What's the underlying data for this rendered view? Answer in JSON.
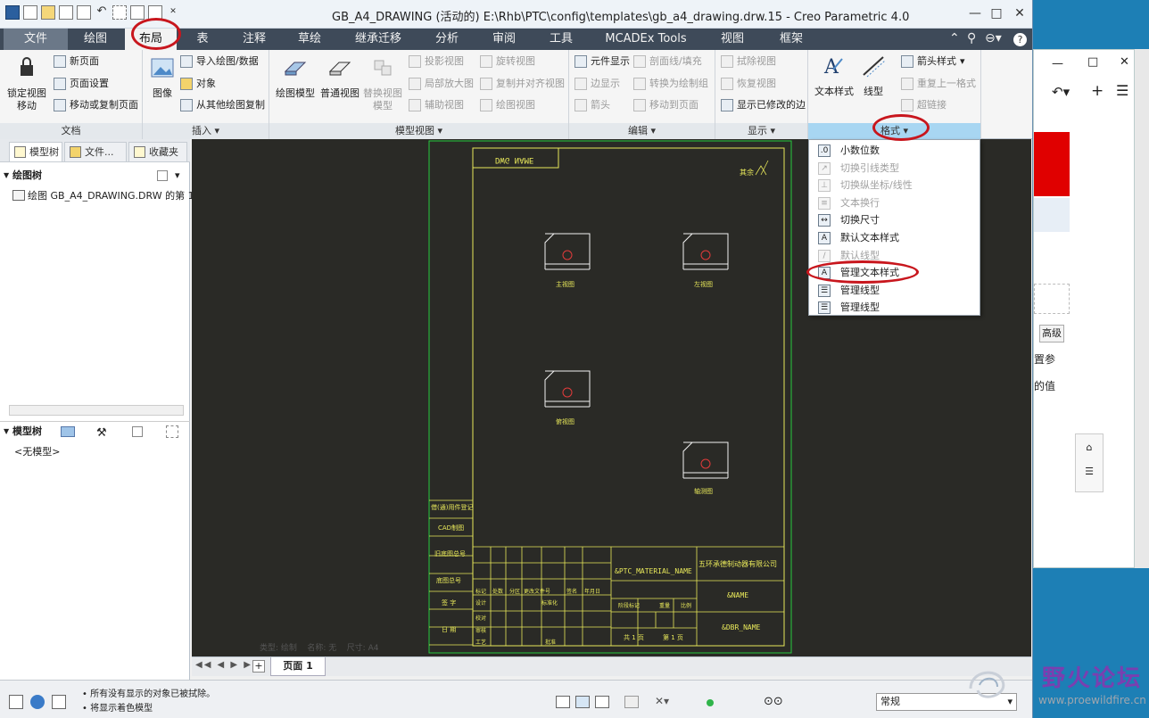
{
  "window": {
    "title": "GB_A4_DRAWING (活动的) E:\\Rhb\\PTC\\config\\templates\\gb_a4_drawing.drw.15 - Creo Parametric 4.0",
    "minimize": "—",
    "maximize": "□",
    "close": "✕"
  },
  "tabs": [
    {
      "label": "文件"
    },
    {
      "label": "绘图"
    },
    {
      "label": "布局"
    },
    {
      "label": "表"
    },
    {
      "label": "注释"
    },
    {
      "label": "草绘"
    },
    {
      "label": "继承迁移"
    },
    {
      "label": "分析"
    },
    {
      "label": "审阅"
    },
    {
      "label": "工具"
    },
    {
      "label": "MCADEx Tools"
    },
    {
      "label": "视图"
    },
    {
      "label": "框架"
    }
  ],
  "ribbon": {
    "doc": {
      "lock_view_move": "锁定视图\n移动",
      "new_page": "新页面",
      "page_setup": "页面设置",
      "move_copy_page": "移动或复制页面",
      "footer": "文档"
    },
    "insert": {
      "image": "图像",
      "import_drawing": "导入绘图/数据",
      "object": "对象",
      "copy_from_drawing": "从其他绘图复制",
      "footer": "插入"
    },
    "model_views": {
      "general_model": "绘图模型",
      "general_view": "普通视图",
      "replace_view": "替换视图\n模型",
      "projection_view": "投影视图",
      "detail_view": "局部放大图",
      "auxiliary_view": "辅助视图",
      "revolved_view": "旋转视图",
      "copy_align_view": "复制并对齐视图",
      "drawing_view": "绘图视图",
      "footer": "模型视图"
    },
    "edit": {
      "element_display": "元件显示",
      "edge_display": "边显示",
      "arrow": "箭头",
      "section_line": "剖面线/填充",
      "convert_to_draft": "转换为绘制组",
      "move_to_page": "移动到页面",
      "footer": "编辑"
    },
    "display": {
      "erase_view": "拭除视图",
      "restore_view": "恢复视图",
      "show_modified_edges": "显示已修改的边",
      "footer": "显示"
    },
    "format": {
      "text_style": "文本样式",
      "line_style": "线型",
      "arrow_style": "箭头样式",
      "repeat_last": "重复上一格式",
      "hyperlink": "超链接",
      "footer": "格式"
    }
  },
  "format_menu": [
    {
      "label": "小数位数",
      "icon": ".0",
      "enabled": true
    },
    {
      "label": "切换引线类型",
      "icon": "↗",
      "enabled": false
    },
    {
      "label": "切换纵坐标/线性",
      "icon": "⊥",
      "enabled": false
    },
    {
      "label": "文本换行",
      "icon": "≡",
      "enabled": false
    },
    {
      "label": "切换尺寸",
      "icon": "↔",
      "enabled": true
    },
    {
      "label": "默认文本样式",
      "icon": "A",
      "enabled": true
    },
    {
      "label": "默认线型",
      "icon": "/",
      "enabled": false
    },
    {
      "label": "管理文本样式",
      "icon": "A",
      "enabled": true
    },
    {
      "label": "管理线型",
      "icon": "☰",
      "enabled": true
    },
    {
      "label": "管理线型",
      "icon": "☰",
      "enabled": true
    }
  ],
  "left_panel": {
    "tabs": [
      "模型树",
      "文件...",
      "收藏夹"
    ],
    "drawing_tree_header": "绘图树",
    "drawing_tree_item": "绘图 GB_A4_DRAWING.DRW 的第 1 页",
    "model_tree_header": "模型树",
    "no_model": "<无模型>"
  },
  "canvas": {
    "title_box": "DWG NAME",
    "surface_mark": "其余",
    "view_labels": [
      "主视图",
      "左视图",
      "俯视图",
      "轴测图"
    ],
    "side_table": [
      "借(通)用件登记",
      "CAD制图",
      "旧底图总号",
      "底图总号",
      "签 字",
      "日 期"
    ],
    "material": "&PTC_MATERIAL_NAME",
    "company": "五环承德制动器有限公司",
    "name": "&NAME",
    "mbr_name": "&DBR_NAME",
    "scale_label": "比例",
    "sheet_of": "第 1 页",
    "sheet_total": "共 1 页",
    "bottom_info": "类型: 绘制    名称: 无    尺寸: A4",
    "table_head": [
      "标记",
      "处数",
      "分区",
      "更改文件号",
      "签名",
      "年月日"
    ],
    "table_rows": [
      "设计",
      "标准化",
      "校对",
      "审核",
      "工艺",
      "批准"
    ],
    "stage_label": "阶段标记",
    "weight_label": "重量",
    "scale_col": "比例"
  },
  "page_tabs": {
    "page1": "页面 1",
    "add": "+"
  },
  "status": {
    "line1": "所有没有显示的对象已被拭除。",
    "line2": "将显示着色模型",
    "filter": "常规"
  },
  "bg_app": {
    "advanced": "高级",
    "set_param": "置参",
    "value": "的值"
  },
  "watermark": {
    "text": "野火论坛",
    "url": "www.proewildfire.cn"
  }
}
